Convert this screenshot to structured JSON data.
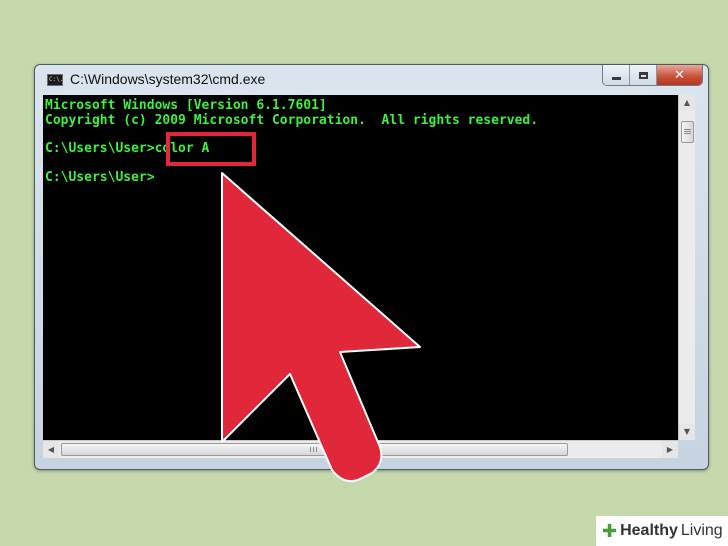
{
  "window": {
    "title": "C:\\Windows\\system32\\cmd.exe",
    "icon_label": "C:\\."
  },
  "console": {
    "lines": [
      "Microsoft Windows [Version 6.1.7601]",
      "Copyright (c) 2009 Microsoft Corporation.  All rights reserved.",
      "",
      "C:\\Users\\User>color A",
      "",
      "C:\\Users\\User>"
    ],
    "text_color": "#3df03d",
    "background_color": "#000000"
  },
  "annotation": {
    "highlight_color": "#e0283a",
    "arrow_color": "#e0283a"
  },
  "icons": {
    "minimize": "minimize-icon",
    "maximize": "maximize-icon",
    "close": "close-icon",
    "scroll_up": "scroll-up-icon",
    "scroll_down": "scroll-down-icon",
    "scroll_left": "scroll-left-icon",
    "scroll_right": "scroll-right-icon"
  },
  "branding": {
    "word1": "Healthy",
    "word2": "Living"
  }
}
